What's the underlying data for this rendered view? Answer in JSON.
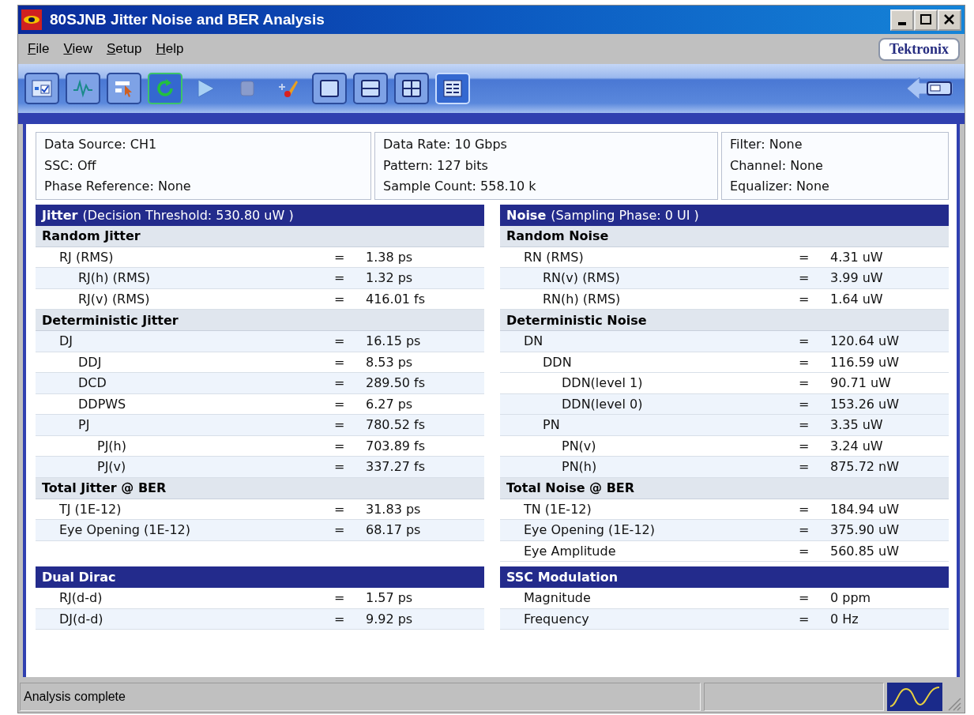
{
  "window": {
    "title": "80SJNB Jitter Noise and BER Analysis"
  },
  "menu": [
    "File",
    "View",
    "Setup",
    "Help"
  ],
  "brand": "Tektronix",
  "toolbar": [
    {
      "kind": "checklist",
      "selected": false
    },
    {
      "kind": "waveform",
      "selected": false
    },
    {
      "kind": "pointer",
      "selected": false
    },
    {
      "kind": "refresh",
      "selected": true
    },
    {
      "kind": "play",
      "selected": false
    },
    {
      "kind": "stop",
      "selected": false
    },
    {
      "kind": "brush",
      "selected": false
    },
    {
      "kind": "single",
      "selected": false
    },
    {
      "kind": "split",
      "selected": false
    },
    {
      "kind": "quad",
      "selected": false
    },
    {
      "kind": "table",
      "selected": true
    },
    {
      "kind": "back",
      "selected": false
    }
  ],
  "info": [
    [
      "Data Source: CH1",
      "SSC: Off",
      "Phase Reference: None"
    ],
    [
      "Data Rate: 10 Gbps",
      "Pattern: 127 bits",
      "Sample Count: 558.10 k"
    ],
    [
      "Filter: None",
      "Channel: None",
      "Equalizer: None"
    ]
  ],
  "panels": [
    {
      "title": "Jitter",
      "subtitle": "(Decision Threshold: 530.80 uW )",
      "sections": [
        {
          "heading": "Random Jitter",
          "rows": [
            {
              "label": "RJ (RMS)",
              "sign": "=",
              "value": "1.38 ps",
              "children": [
                {
                  "label": "RJ(h) (RMS)",
                  "sign": "=",
                  "value": "1.32 ps"
                },
                {
                  "label": "RJ(v) (RMS)",
                  "sign": "=",
                  "value": "416.01 fs"
                }
              ]
            }
          ]
        },
        {
          "heading": "Deterministic Jitter",
          "rows": [
            {
              "label": "DJ",
              "sign": "=",
              "value": "16.15 ps",
              "children": [
                {
                  "label": "DDJ",
                  "sign": "=",
                  "value": "8.53 ps"
                },
                {
                  "label": "DCD",
                  "sign": "=",
                  "value": "289.50 fs"
                },
                {
                  "label": "DDPWS",
                  "sign": "=",
                  "value": "6.27 ps"
                },
                {
                  "label": "PJ",
                  "sign": "=",
                  "value": "780.52 fs",
                  "children": [
                    {
                      "label": "PJ(h)",
                      "sign": "=",
                      "value": "703.89 fs"
                    },
                    {
                      "label": "PJ(v)",
                      "sign": "=",
                      "value": "337.27 fs"
                    }
                  ]
                }
              ]
            }
          ]
        },
        {
          "heading": "Total Jitter @ BER",
          "rows": [
            {
              "label": "TJ (1E-12)",
              "sign": "=",
              "value": "31.83 ps"
            },
            {
              "label": "Eye Opening (1E-12)",
              "sign": "=",
              "value": "68.17 ps"
            }
          ]
        }
      ]
    },
    {
      "title": "Noise",
      "subtitle": "(Sampling Phase: 0 UI )",
      "sections": [
        {
          "heading": "Random Noise",
          "rows": [
            {
              "label": "RN (RMS)",
              "sign": "=",
              "value": "4.31 uW",
              "children": [
                {
                  "label": "RN(v) (RMS)",
                  "sign": "=",
                  "value": "3.99 uW"
                },
                {
                  "label": "RN(h) (RMS)",
                  "sign": "=",
                  "value": "1.64 uW"
                }
              ]
            }
          ]
        },
        {
          "heading": "Deterministic Noise",
          "rows": [
            {
              "label": "DN",
              "sign": "=",
              "value": "120.64 uW",
              "children": [
                {
                  "label": "DDN",
                  "sign": "=",
                  "value": "116.59 uW",
                  "children": [
                    {
                      "label": "DDN(level 1)",
                      "sign": "=",
                      "value": "90.71 uW"
                    },
                    {
                      "label": "DDN(level 0)",
                      "sign": "=",
                      "value": "153.26 uW"
                    }
                  ]
                },
                {
                  "label": "PN",
                  "sign": "=",
                  "value": "3.35 uW",
                  "children": [
                    {
                      "label": "PN(v)",
                      "sign": "=",
                      "value": "3.24 uW"
                    },
                    {
                      "label": "PN(h)",
                      "sign": "=",
                      "value": "875.72 nW"
                    }
                  ]
                }
              ]
            }
          ]
        },
        {
          "heading": "Total Noise @ BER",
          "rows": [
            {
              "label": "TN (1E-12)",
              "sign": "=",
              "value": "184.94 uW"
            },
            {
              "label": "Eye Opening (1E-12)",
              "sign": "=",
              "value": "375.90 uW"
            },
            {
              "label": "Eye Amplitude",
              "sign": "=",
              "value": "560.85 uW"
            }
          ]
        }
      ]
    },
    {
      "title": "Dual Dirac",
      "sections": [
        {
          "rows": [
            {
              "label": "RJ(d-d)",
              "sign": "=",
              "value": "1.57 ps"
            },
            {
              "label": "DJ(d-d)",
              "sign": "=",
              "value": "9.92 ps"
            }
          ]
        }
      ]
    },
    {
      "title": "SSC Modulation",
      "sections": [
        {
          "rows": [
            {
              "label": "Magnitude",
              "sign": "=",
              "value": "0 ppm"
            },
            {
              "label": "Frequency",
              "sign": "=",
              "value": "0 Hz"
            }
          ]
        }
      ]
    }
  ],
  "status_bar": {
    "message": "Analysis complete"
  }
}
